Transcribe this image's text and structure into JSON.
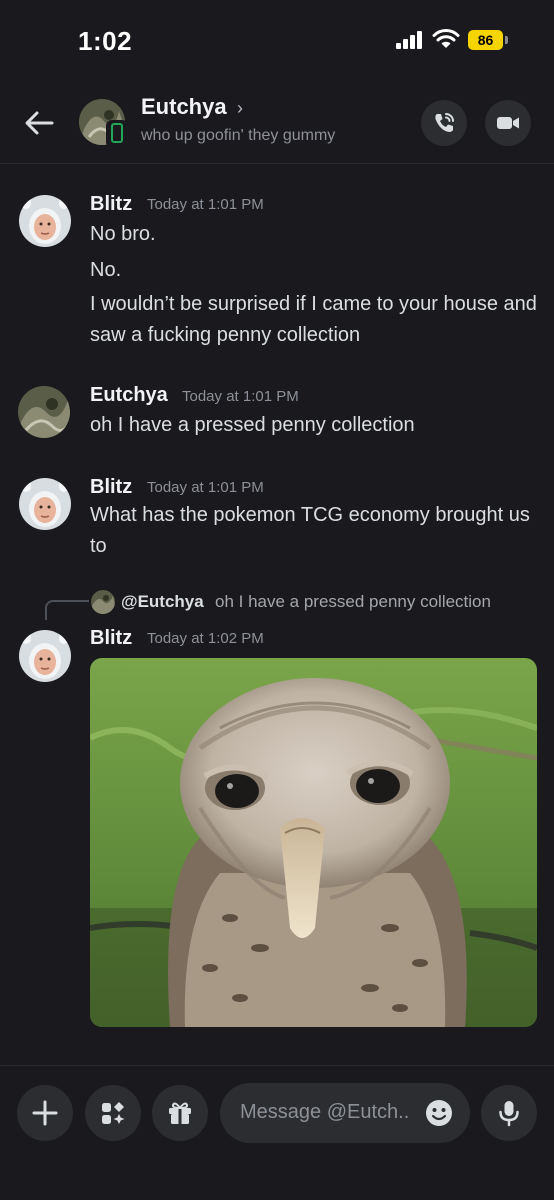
{
  "status_bar": {
    "time": "1:02",
    "battery": "86"
  },
  "header": {
    "name": "Eutchya",
    "chevron": "›",
    "status": "who up goofin' they gummy"
  },
  "messages": [
    {
      "author": "Blitz",
      "time": "Today at 1:01 PM",
      "lines": [
        "No bro.",
        "No.",
        "I wouldn’t be surprised if I came to your house and saw a fucking penny collection"
      ]
    },
    {
      "author": "Eutchya",
      "time": "Today at 1:01 PM",
      "lines": [
        "oh I have a pressed penny collection"
      ]
    },
    {
      "author": "Blitz",
      "time": "Today at 1:01 PM",
      "lines": [
        "What has the pokemon TCG economy brought us to"
      ]
    },
    {
      "author": "Blitz",
      "time": "Today at 1:02 PM",
      "reply": {
        "name": "@Eutchya",
        "text": "oh I have a pressed penny collection"
      },
      "attachment": "owl-image"
    }
  ],
  "composer": {
    "placeholder": "Message @Eutch.."
  },
  "icons": {
    "back": "arrow-left-icon",
    "call": "phone-icon",
    "video": "video-camera-icon",
    "add": "plus-icon",
    "apps": "apps-icon",
    "gift": "gift-icon",
    "emoji": "emoji-icon",
    "mic": "microphone-icon"
  },
  "colors": {
    "background": "#1a1a1e",
    "online": "#23a55a",
    "battery": "#f5d400"
  }
}
